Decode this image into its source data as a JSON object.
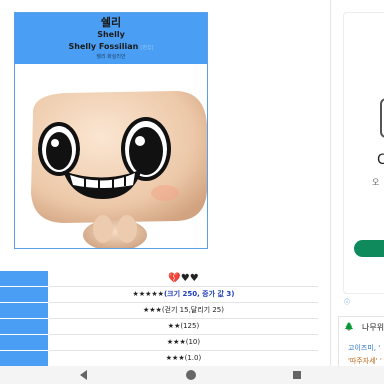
{
  "infobox": {
    "name_ko": "쉘리",
    "name_en": "Shelly",
    "full_name": "Shelly Fossilian",
    "edit_link": "[편집]",
    "subtitle": "쉘리 화실리안"
  },
  "stats": [
    {
      "hearts": "💔♥♥",
      "stars": "",
      "note": ""
    },
    {
      "hearts": "",
      "stars": "★★★★★",
      "note": "(크기 250, 증가 값 3)"
    },
    {
      "hearts": "",
      "stars": "★★★",
      "note": "(걷기 15,달리기 25)"
    },
    {
      "hearts": "",
      "stars": "★★",
      "note": "(125)"
    },
    {
      "hearts": "",
      "stars": "★★★",
      "note": "(10)"
    },
    {
      "hearts": "",
      "stars": "★★★",
      "note": "(1.0)"
    }
  ],
  "side_panel": {
    "letter": "C",
    "small_text": "오",
    "link_text": "ⓘ",
    "tree_icon": "🌲",
    "title": "나무위",
    "item1": "고이즈미, '",
    "item2": "'따주자세' '"
  },
  "colors": {
    "header_blue": "#4a9ff5",
    "install_green": "#0f8a5c"
  }
}
